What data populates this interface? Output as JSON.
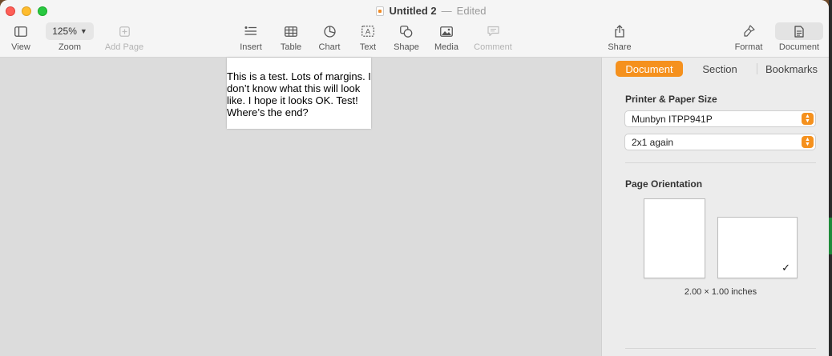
{
  "window": {
    "title": "Untitled 2",
    "separator": "—",
    "status": "Edited"
  },
  "toolbar": {
    "view_label": "View",
    "zoom_value": "125%",
    "zoom_label": "Zoom",
    "add_page_label": "Add Page",
    "insert_label": "Insert",
    "table_label": "Table",
    "chart_label": "Chart",
    "text_label": "Text",
    "shape_label": "Shape",
    "media_label": "Media",
    "comment_label": "Comment",
    "share_label": "Share",
    "format_label": "Format",
    "document_label": "Document"
  },
  "page": {
    "text": "This is a test.  Lots of margins.  I don’t know what this will look like.  I hope it looks OK.  Test! Where’s the end?"
  },
  "sidebar": {
    "tabs": [
      "Document",
      "Section",
      "Bookmarks"
    ],
    "active_tab": "Document",
    "printer_section_label": "Printer & Paper Size",
    "printer_value": "Munbyn ITPP941P",
    "paper_value": "2x1 again",
    "orientation_label": "Page Orientation",
    "selected_orientation": "landscape",
    "paper_dimensions": "2.00 × 1.00 inches"
  },
  "colors": {
    "accent": "#f5911e",
    "canvas": "#dcdcdc",
    "sidebar": "#ececec"
  },
  "icons": {
    "view": "sidebar-view-icon",
    "add_page": "plus-square-icon",
    "insert": "insert-list-icon",
    "table": "table-icon",
    "chart": "chart-icon",
    "text": "text-box-icon",
    "shape": "shape-icon",
    "media": "photo-icon",
    "comment": "comment-icon",
    "share": "share-icon",
    "format": "paintbrush-icon",
    "document": "document-icon"
  }
}
